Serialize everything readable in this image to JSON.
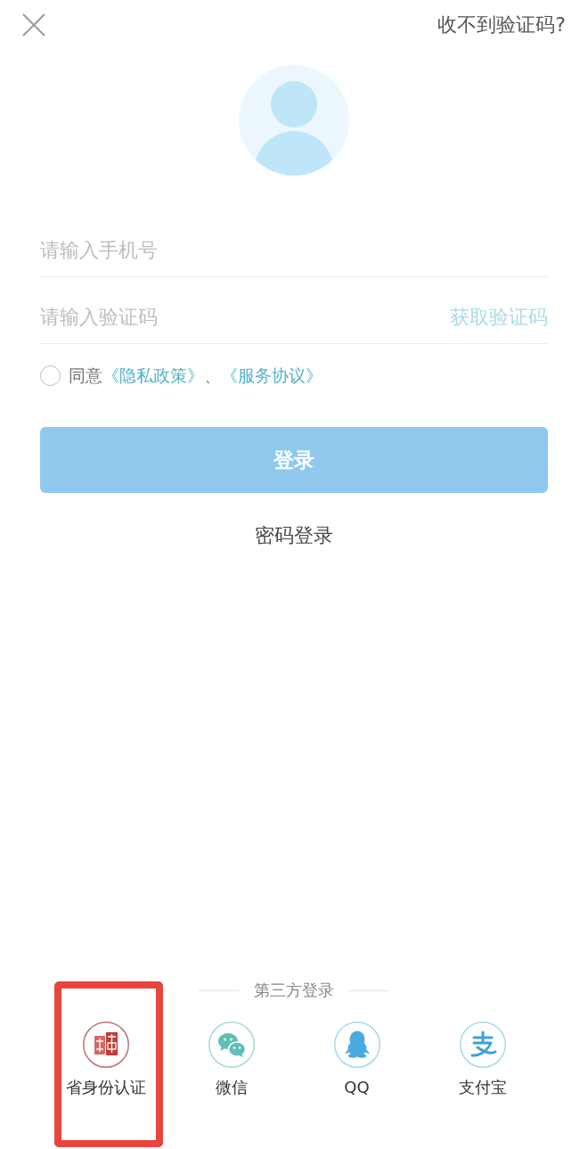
{
  "top_bar": {
    "help_link": "收不到验证码?"
  },
  "form": {
    "phone": {
      "placeholder": "请输入手机号"
    },
    "code": {
      "placeholder": "请输入验证码",
      "action": {
        "label": "获取验证码",
        "disabled": true
      }
    }
  },
  "agreement": {
    "checked": false,
    "prefix": "同意",
    "links": [
      "《隐私政策》",
      "《服务协议》"
    ],
    "separator": "、"
  },
  "login_button": {
    "label": "登录",
    "disabled": true
  },
  "password_login": "密码登录",
  "third_party": {
    "title": "第三方登录",
    "options": [
      {
        "kind": "seal",
        "label": "省身份认证",
        "highlighted": true
      },
      {
        "kind": "chat",
        "label": "微信",
        "highlighted": false
      },
      {
        "kind": "penguin",
        "label": "QQ",
        "highlighted": false
      },
      {
        "kind": "zhi",
        "label": "支付宝",
        "highlighted": false
      }
    ]
  }
}
